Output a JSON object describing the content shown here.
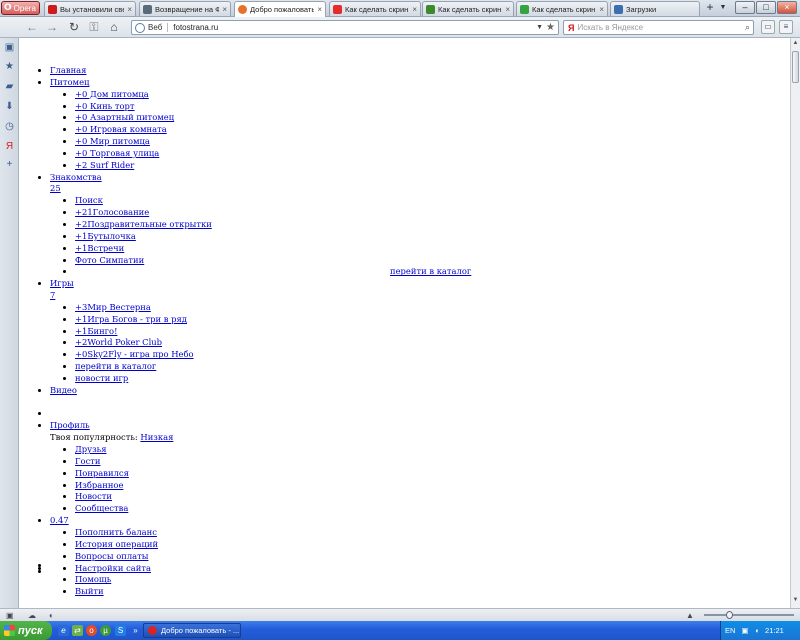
{
  "browser": {
    "menu_label": "Opera",
    "tabs": [
      {
        "title": "Вы установили све...",
        "close": "×",
        "icon": "opera-icon",
        "color": "#cc1b1b"
      },
      {
        "title": "Возвращение на Ф...",
        "close": "×",
        "icon": "page-icon",
        "color": "#5a6b7c"
      },
      {
        "title": "Добро пожаловать",
        "close": "×",
        "icon": "fotostrana-icon",
        "color": "#e8702a",
        "active": true
      },
      {
        "title": "Как сделать скрин...",
        "close": "×",
        "icon": "yandex-icon",
        "color": "#e62b2b"
      },
      {
        "title": "Как сделать скрин...",
        "close": "×",
        "icon": "question-icon",
        "color": "#3b8a2c"
      },
      {
        "title": "Как сделать скрин...",
        "close": "×",
        "icon": "answer-icon",
        "color": "#37a33f"
      },
      {
        "title": "Загрузки",
        "close": "",
        "icon": "downloads-icon",
        "color": "#3b6fb0"
      }
    ],
    "new_tab": "+",
    "window_buttons": {
      "minimize": "–",
      "maximize": "□",
      "close": "×"
    },
    "address": {
      "label": "Веб",
      "value": "fotostrana.ru"
    },
    "search": {
      "placeholder": "Искать в Яндексе",
      "engine": "Я"
    }
  },
  "page": {
    "menu": [
      {
        "label": "Главная"
      },
      {
        "label": "Питомец",
        "items": [
          "+0 Дом питомца",
          "+0 Кинь торт",
          "+0 Азартный питомец",
          "+0 Игровая комната",
          "+0 Мир питомца",
          "+0 Торговая улица",
          "+2 Surf Rider"
        ]
      },
      {
        "label": "Знакомства",
        "count": "25",
        "items": [
          "Поиск",
          "+21Голосование",
          "+2Поздравительные открытки",
          "+1Бутылочка",
          "+1Встречи",
          "Фото Симпатии"
        ],
        "catalog_link": "перейти в каталог"
      },
      {
        "label": "Игры",
        "count": "7",
        "items": [
          "+3Мир Вестерна",
          "+1Игра Богов - три в ряд",
          "+1Бинго!",
          "+2World Poker Club",
          "+0Sky2Fly - игра про Небо",
          "перейти в каталог",
          "новости игр"
        ]
      },
      {
        "label": "Видео"
      },
      {
        "label": "Профиль",
        "popularity_label": "Твоя популярность:",
        "popularity_value": "Низкая",
        "items": [
          "Друзья",
          "Гости",
          "Понравился",
          "Избранное",
          "Новости",
          "Сообщества"
        ]
      },
      {
        "label": "0.47",
        "items": [
          "Пополнить баланс",
          "История операций",
          "Вопросы оплаты"
        ]
      },
      {
        "settings": [
          "Настройки сайта",
          "Помощь",
          "Выйти"
        ]
      }
    ]
  },
  "taskbar": {
    "start_label": "пуск",
    "task_title": "Добро пожаловать - ...",
    "lang": "EN",
    "time": "21:21"
  }
}
